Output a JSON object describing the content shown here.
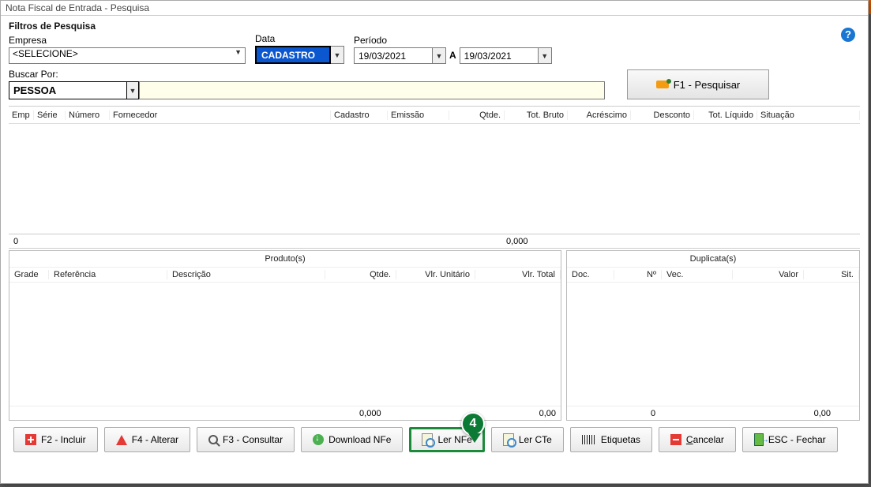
{
  "window_title": "Nota Fiscal de Entrada - Pesquisa",
  "filter_header": "Filtros de Pesquisa",
  "empresa": {
    "label": "Empresa",
    "value": "<SELECIONE>"
  },
  "data_sel": {
    "label": "Data",
    "value": "CADASTRO"
  },
  "periodo": {
    "label": "Período",
    "from": "19/03/2021",
    "sep": "A",
    "to": "19/03/2021"
  },
  "buscar": {
    "label": "Buscar Por:",
    "value": "PESSOA",
    "input": ""
  },
  "btn_pesquisar": "F1 - Pesquisar",
  "grid": {
    "headers": [
      "Emp",
      "Série",
      "Número",
      "Fornecedor",
      "Cadastro",
      "Emissão",
      "Qtde.",
      "Tot. Bruto",
      "Acréscimo",
      "Desconto",
      "Tot. Líquido",
      "Situação"
    ],
    "summary_zero": "0",
    "summary_qtde": "0,000"
  },
  "products": {
    "title": "Produto(s)",
    "headers": [
      "Grade",
      "Referência",
      "Descrição",
      "Qtde.",
      "Vlr. Unitário",
      "Vlr. Total"
    ],
    "foot_qtde": "0,000",
    "foot_total": "0,00"
  },
  "duplicatas": {
    "title": "Duplicata(s)",
    "headers": [
      "Doc.",
      "Nº",
      "Vec.",
      "Valor",
      "Sit."
    ],
    "foot_count": "0",
    "foot_valor": "0,00"
  },
  "toolbar": {
    "incluir": "F2 - Incluir",
    "alterar": "F4 - Alterar",
    "consultar": "F3 - Consultar",
    "download": "Download NFe",
    "lernfe": "Ler NFe",
    "lercte": "Ler CTe",
    "etiquetas": "Etiquetas",
    "cancelar_pre": "C",
    "cancelar_post": "ancelar",
    "fechar": "ESC - Fechar"
  },
  "marker": "4"
}
